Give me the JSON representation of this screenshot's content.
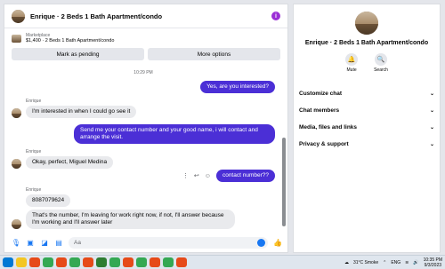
{
  "chat": {
    "title": "Enrique · 2 Beds 1 Bath Apartment/condo",
    "marketplace_label": "Marketplace",
    "marketplace_item": "$1,400 · 2 Beds 1 Bath Apartment/condo",
    "mark_pending": "Mark as pending",
    "more_options": "More options",
    "time_separator": "10:29 PM",
    "messages": [
      {
        "dir": "out",
        "text": "Yes, are you interested?"
      },
      {
        "dir": "in",
        "sender": "Enrique",
        "text": "I'm interested in when I could go see it"
      },
      {
        "dir": "out",
        "text": "Send me your contact number and your good name, i will contact and arrange the visit."
      },
      {
        "dir": "in",
        "sender": "Enrique",
        "text": "Okay, perfect, Miguel Medina"
      },
      {
        "dir": "out",
        "text": "contact number??"
      },
      {
        "dir": "in",
        "sender": "Enrique",
        "text": "8087079624"
      },
      {
        "dir": "in",
        "text": "That's the number, I'm leaving for work right now, if not, I'll answer because I'm working and I'll answer later"
      }
    ],
    "composer_placeholder": "Aa"
  },
  "info": {
    "title": "Enrique · 2 Beds 1 Bath Apartment/condo",
    "mute": "Mute",
    "search": "Search",
    "menu": [
      "Customize chat",
      "Chat members",
      "Media, files and links",
      "Privacy & support"
    ]
  },
  "taskbar": {
    "weather": "31°C Smoke",
    "lang": "ENG",
    "time": "10:35 PM",
    "date": "9/3/2023"
  }
}
